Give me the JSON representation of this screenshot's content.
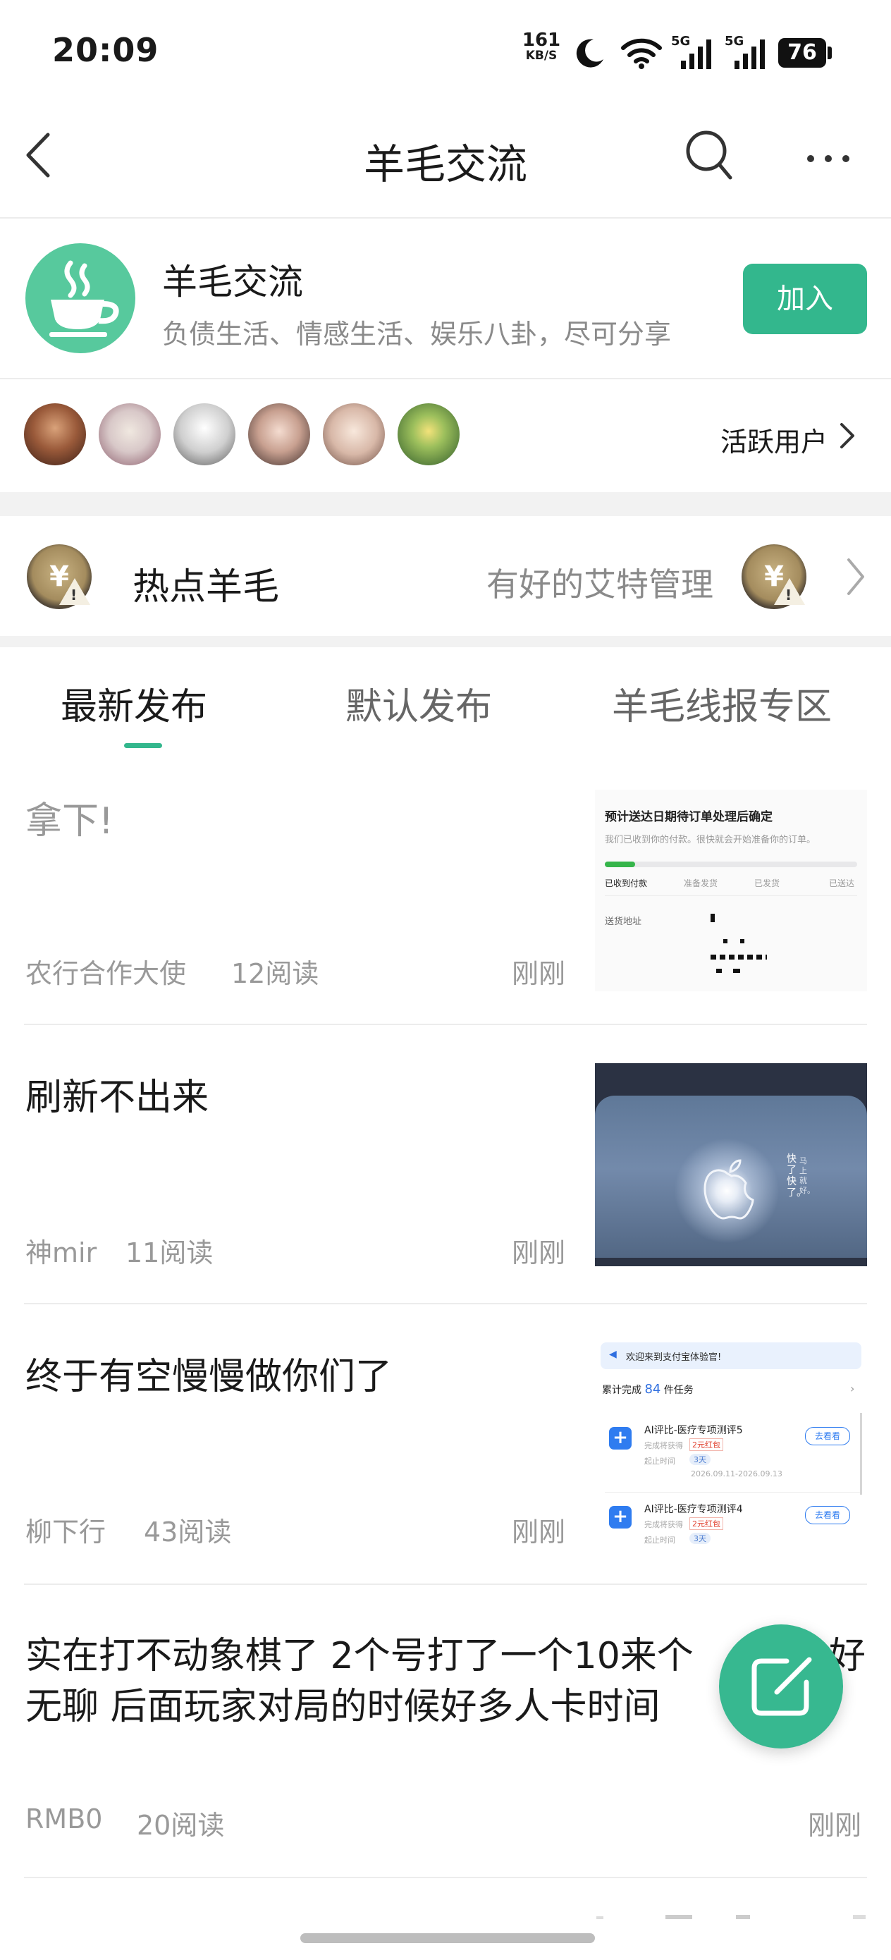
{
  "status_bar": {
    "time": "20:09",
    "net_speed_value": "161",
    "net_speed_unit": "KB/S",
    "signal_1_label": "5G",
    "signal_2_label": "5G",
    "battery": "76",
    "icons": [
      "moon-icon",
      "wifi-icon",
      "signal-icon",
      "battery-icon"
    ]
  },
  "header": {
    "title": "羊毛交流",
    "icons": [
      "back-icon",
      "search-icon",
      "more-icon"
    ]
  },
  "group": {
    "name": "羊毛交流",
    "description": "负债生活、情感生活、娱乐八卦，尽可分享",
    "join_label": "加入",
    "avatar_icon": "coffee-cup-icon",
    "brand_color": "#33b78d"
  },
  "active_users": {
    "label": "活跃用户",
    "count_shown": 6
  },
  "hot_section": {
    "label": "热点羊毛",
    "admin_name": "有好的艾特管理"
  },
  "tabs": [
    {
      "label": "最新发布",
      "active": true
    },
    {
      "label": "默认发布",
      "active": false
    },
    {
      "label": "羊毛线报专区",
      "active": false
    }
  ],
  "posts": [
    {
      "title": "拿下!",
      "author": "农行合作大使",
      "reads": "12阅读",
      "time": "刚刚",
      "thumb": {
        "heading": "预计送达日期待订单处理后确定",
        "sub": "我们已收到你的付款。很快就会开始准备你的订单。",
        "steps": [
          "已收到付款",
          "准备发货",
          "已发货",
          "已送达"
        ],
        "address_label": "送货地址"
      }
    },
    {
      "title": "刷新不出来",
      "author": "神mir",
      "reads": "11阅读",
      "time": "刚刚",
      "thumb": {
        "caption_1": "快了快了。",
        "caption_2": "马上就好。"
      }
    },
    {
      "title": "终于有空慢慢做你们了",
      "author": "柳下行",
      "reads": "43阅读",
      "time": "刚刚",
      "thumb": {
        "banner": "欢迎来到支付宝体验官!",
        "completed_prefix": "累计完成",
        "completed_count": "84",
        "completed_suffix": "件任务",
        "task_1_title": "AI评比-医疗专项测评5",
        "task_1_reward_prefix": "完成将获得",
        "task_1_reward": "2元红包",
        "task_1_time_label": "起止时间",
        "task_1_days": "3天",
        "task_1_range": "2026.09.11-2026.09.13",
        "task_2_title": "AI评比-医疗专项测评4",
        "task_2_reward_prefix": "完成将获得",
        "task_2_reward": "2元红包",
        "task_2_time_label": "起止时间",
        "task_2_days": "3天",
        "button_label": "去看看"
      }
    },
    {
      "title_line_1": "实在打不动象棋了 2个号打了一个10来个",
      "title_line_1_end": "好",
      "title_line_2": "无聊 后面玩家对局的时候好多人卡时间",
      "author": "RMB0",
      "reads": "20阅读",
      "time": "刚刚"
    }
  ],
  "fab": {
    "icon": "compose-icon"
  }
}
